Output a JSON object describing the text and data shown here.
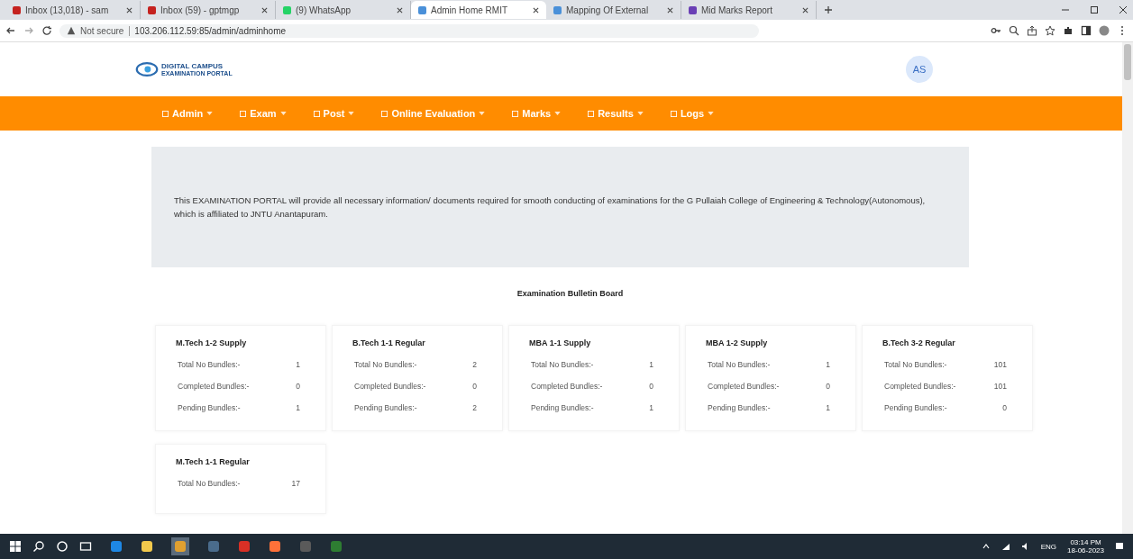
{
  "browser": {
    "tabs": [
      {
        "title": "Inbox (13,018) - sam",
        "kind": "mail",
        "selected": false
      },
      {
        "title": "Inbox (59) - gptmgp",
        "kind": "mail",
        "selected": false
      },
      {
        "title": "(9) WhatsApp",
        "kind": "chat",
        "selected": false
      },
      {
        "title": "Admin Home RMIT",
        "kind": "page",
        "selected": true
      },
      {
        "title": "Mapping Of External",
        "kind": "page",
        "selected": false
      },
      {
        "title": "Mid Marks Report",
        "kind": "report",
        "selected": false
      }
    ],
    "security": "Not secure",
    "url": "103.206.112.59:85/admin/adminhome"
  },
  "header": {
    "logo_text": "DIGITAL CAMPUS",
    "logo_subtext": "EXAMINATION PORTAL",
    "avatar": "AS"
  },
  "nav": [
    {
      "label": "Admin"
    },
    {
      "label": "Exam"
    },
    {
      "label": "Post"
    },
    {
      "label": "Online Evaluation"
    },
    {
      "label": "Marks"
    },
    {
      "label": "Results"
    },
    {
      "label": "Logs"
    }
  ],
  "banner": "This EXAMINATION PORTAL will provide all necessary information/ documents required for smooth conducting of examinations for  the G Pullaiah College of Engineering & Technology(Autonomous), which is affiliated to JNTU Anantapuram.",
  "bulletin_title": "Examination Bulletin Board",
  "cards": [
    {
      "title": "M.Tech 1-2 Supply",
      "rows": [
        {
          "label": "Total No Bundles:-",
          "value": "1"
        },
        {
          "label": "Completed Bundles:-",
          "value": "0"
        },
        {
          "label": "Pending Bundles:-",
          "value": "1"
        }
      ]
    },
    {
      "title": "B.Tech 1-1 Regular",
      "rows": [
        {
          "label": "Total No Bundles:-",
          "value": "2"
        },
        {
          "label": "Completed Bundles:-",
          "value": "0"
        },
        {
          "label": "Pending Bundles:-",
          "value": "2"
        }
      ]
    },
    {
      "title": "MBA 1-1 Supply",
      "rows": [
        {
          "label": "Total No Bundles:-",
          "value": "1"
        },
        {
          "label": "Completed Bundles:-",
          "value": "0"
        },
        {
          "label": "Pending Bundles:-",
          "value": "1"
        }
      ]
    },
    {
      "title": "MBA 1-2 Supply",
      "rows": [
        {
          "label": "Total No Bundles:-",
          "value": "1"
        },
        {
          "label": "Completed Bundles:-",
          "value": "0"
        },
        {
          "label": "Pending Bundles:-",
          "value": "1"
        }
      ]
    },
    {
      "title": "B.Tech 3-2 Regular",
      "rows": [
        {
          "label": "Total No Bundles:-",
          "value": "101"
        },
        {
          "label": "Completed Bundles:-",
          "value": "101"
        },
        {
          "label": "Pending Bundles:-",
          "value": "0"
        }
      ]
    },
    {
      "title": "M.Tech 1-1 Regular",
      "rows": [
        {
          "label": "Total No Bundles:-",
          "value": "17"
        }
      ]
    }
  ],
  "taskbar": {
    "language": "ENG",
    "time": "03:14 PM",
    "date": "18-06-2023"
  }
}
